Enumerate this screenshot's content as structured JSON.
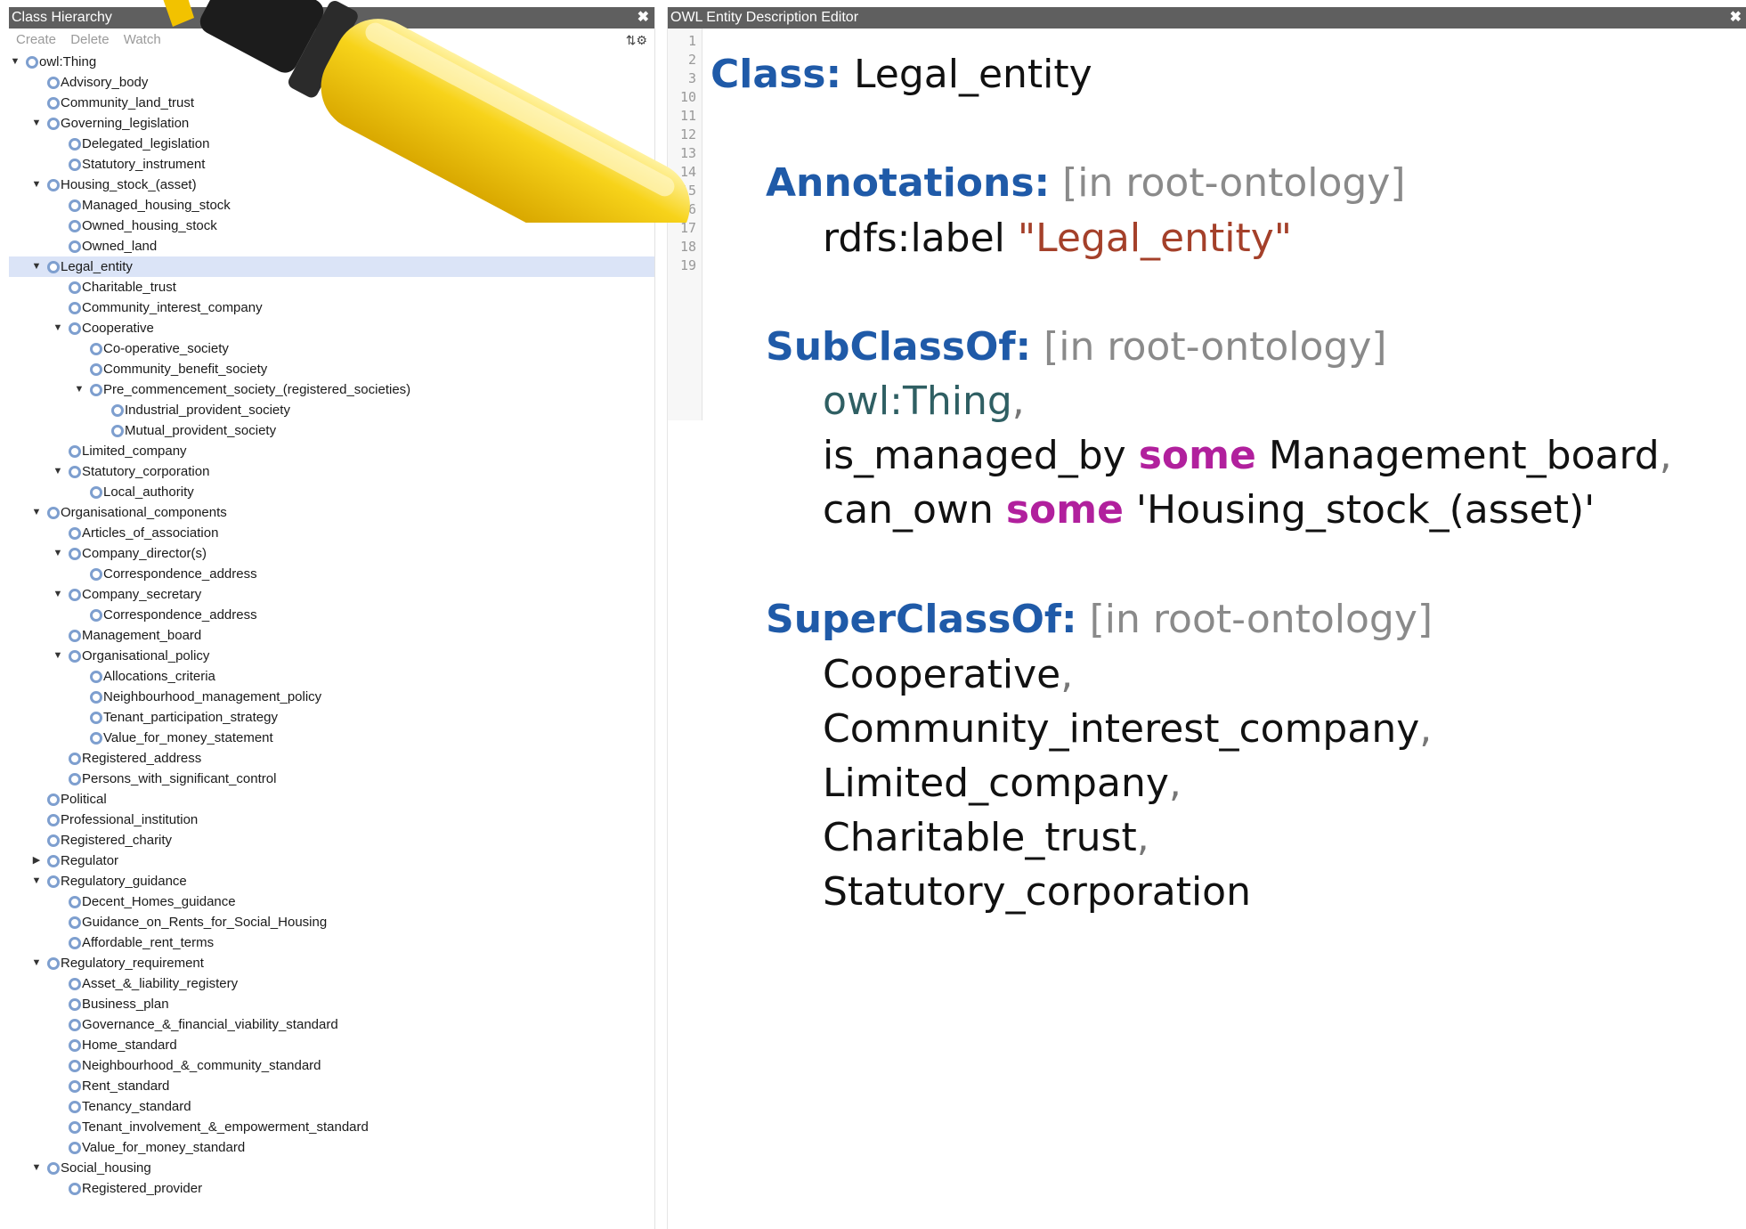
{
  "left_panel": {
    "title": "Class Hierarchy",
    "close_icon": "close-icon",
    "toolbar": {
      "create": "Create",
      "delete": "Delete",
      "watch": "Watch",
      "options_icon": "options-icon"
    }
  },
  "tree": [
    {
      "label": "owl:Thing",
      "depth": 0,
      "toggle": "expanded"
    },
    {
      "label": "Advisory_body",
      "depth": 1,
      "toggle": "none"
    },
    {
      "label": "Community_land_trust",
      "depth": 1,
      "toggle": "none"
    },
    {
      "label": "Governing_legislation",
      "depth": 1,
      "toggle": "expanded"
    },
    {
      "label": "Delegated_legislation",
      "depth": 2,
      "toggle": "none"
    },
    {
      "label": "Statutory_instrument",
      "depth": 2,
      "toggle": "none"
    },
    {
      "label": "Housing_stock_(asset)",
      "depth": 1,
      "toggle": "expanded"
    },
    {
      "label": "Managed_housing_stock",
      "depth": 2,
      "toggle": "none"
    },
    {
      "label": "Owned_housing_stock",
      "depth": 2,
      "toggle": "none"
    },
    {
      "label": "Owned_land",
      "depth": 2,
      "toggle": "none"
    },
    {
      "label": "Legal_entity",
      "depth": 1,
      "toggle": "expanded",
      "selected": true
    },
    {
      "label": "Charitable_trust",
      "depth": 2,
      "toggle": "none"
    },
    {
      "label": "Community_interest_company",
      "depth": 2,
      "toggle": "none"
    },
    {
      "label": "Cooperative",
      "depth": 2,
      "toggle": "expanded"
    },
    {
      "label": "Co-operative_society",
      "depth": 3,
      "toggle": "none"
    },
    {
      "label": "Community_benefit_society",
      "depth": 3,
      "toggle": "none"
    },
    {
      "label": "Pre_commencement_society_(registered_societies)",
      "depth": 3,
      "toggle": "expanded"
    },
    {
      "label": "Industrial_provident_society",
      "depth": 4,
      "toggle": "none"
    },
    {
      "label": "Mutual_provident_society",
      "depth": 4,
      "toggle": "none"
    },
    {
      "label": "Limited_company",
      "depth": 2,
      "toggle": "none"
    },
    {
      "label": "Statutory_corporation",
      "depth": 2,
      "toggle": "expanded"
    },
    {
      "label": "Local_authority",
      "depth": 3,
      "toggle": "none"
    },
    {
      "label": "Organisational_components",
      "depth": 1,
      "toggle": "expanded"
    },
    {
      "label": "Articles_of_association",
      "depth": 2,
      "toggle": "none"
    },
    {
      "label": "Company_director(s)",
      "depth": 2,
      "toggle": "expanded"
    },
    {
      "label": "Correspondence_address",
      "depth": 3,
      "toggle": "none"
    },
    {
      "label": "Company_secretary",
      "depth": 2,
      "toggle": "expanded"
    },
    {
      "label": "Correspondence_address",
      "depth": 3,
      "toggle": "none"
    },
    {
      "label": "Management_board",
      "depth": 2,
      "toggle": "none"
    },
    {
      "label": "Organisational_policy",
      "depth": 2,
      "toggle": "expanded"
    },
    {
      "label": "Allocations_criteria",
      "depth": 3,
      "toggle": "none"
    },
    {
      "label": "Neighbourhood_management_policy",
      "depth": 3,
      "toggle": "none"
    },
    {
      "label": "Tenant_participation_strategy",
      "depth": 3,
      "toggle": "none"
    },
    {
      "label": "Value_for_money_statement",
      "depth": 3,
      "toggle": "none"
    },
    {
      "label": "Registered_address",
      "depth": 2,
      "toggle": "none"
    },
    {
      "label": "Persons_with_significant_control",
      "depth": 2,
      "toggle": "none"
    },
    {
      "label": "Political",
      "depth": 1,
      "toggle": "none"
    },
    {
      "label": "Professional_institution",
      "depth": 1,
      "toggle": "none"
    },
    {
      "label": "Registered_charity",
      "depth": 1,
      "toggle": "none"
    },
    {
      "label": "Regulator",
      "depth": 1,
      "toggle": "collapsed"
    },
    {
      "label": "Regulatory_guidance",
      "depth": 1,
      "toggle": "expanded"
    },
    {
      "label": "Decent_Homes_guidance",
      "depth": 2,
      "toggle": "none"
    },
    {
      "label": "Guidance_on_Rents_for_Social_Housing",
      "depth": 2,
      "toggle": "none"
    },
    {
      "label": "Affordable_rent_terms",
      "depth": 2,
      "toggle": "none"
    },
    {
      "label": "Regulatory_requirement",
      "depth": 1,
      "toggle": "expanded"
    },
    {
      "label": "Asset_&_liability_registery",
      "depth": 2,
      "toggle": "none"
    },
    {
      "label": "Business_plan",
      "depth": 2,
      "toggle": "none"
    },
    {
      "label": "Governance_&_financial_viability_standard",
      "depth": 2,
      "toggle": "none"
    },
    {
      "label": "Home_standard",
      "depth": 2,
      "toggle": "none"
    },
    {
      "label": "Neighbourhood_&_community_standard",
      "depth": 2,
      "toggle": "none"
    },
    {
      "label": "Rent_standard",
      "depth": 2,
      "toggle": "none"
    },
    {
      "label": "Tenancy_standard",
      "depth": 2,
      "toggle": "none"
    },
    {
      "label": "Tenant_involvement_&_empowerment_standard",
      "depth": 2,
      "toggle": "none"
    },
    {
      "label": "Value_for_money_standard",
      "depth": 2,
      "toggle": "none"
    },
    {
      "label": "Social_housing",
      "depth": 1,
      "toggle": "expanded"
    },
    {
      "label": "Registered_provider",
      "depth": 2,
      "toggle": "none"
    }
  ],
  "right_panel": {
    "title": "OWL Entity Description Editor",
    "close_icon": "close-icon",
    "line_numbers": [
      "1",
      "2",
      "3",
      "10",
      "11",
      "12",
      "13",
      "14",
      "15",
      "16",
      "17",
      "18",
      "19"
    ]
  },
  "editor": {
    "class_kw": "Class:",
    "class_name": "Legal_entity",
    "annotations_kw": "Annotations:",
    "annotations_ctx": "[in root-ontology]",
    "label_prop": "rdfs:label ",
    "label_value": "\"Legal_entity\"",
    "subclassof_kw": "SubClassOf:",
    "subclassof_ctx": "[in root-ontology]",
    "sub_1": "owl:Thing",
    "sub_2_prop": "is_managed_by ",
    "sub_2_some": "some",
    "sub_2_val": " Management_board",
    "sub_3_prop": "can_own ",
    "sub_3_some": "some",
    "sub_3_val": " 'Housing_stock_(asset)'",
    "superclassof_kw": "SuperClassOf:",
    "superclassof_ctx": "[in root-ontology]",
    "super_items": [
      "Cooperative",
      "Community_interest_company",
      "Limited_company",
      "Charitable_trust",
      "Statutory_corporation"
    ],
    "comma": ","
  },
  "colors": {
    "keyword": "#1f5aa8",
    "some": "#b1209d",
    "string": "#a4402a",
    "selection": "#dbe4f7",
    "class_icon": "#7e9fcf",
    "highlighter_body": "#f7d31a",
    "highlighter_cap": "#1c1c1c"
  },
  "overlay": {
    "highlighter_icon": "highlighter-marker-icon"
  }
}
